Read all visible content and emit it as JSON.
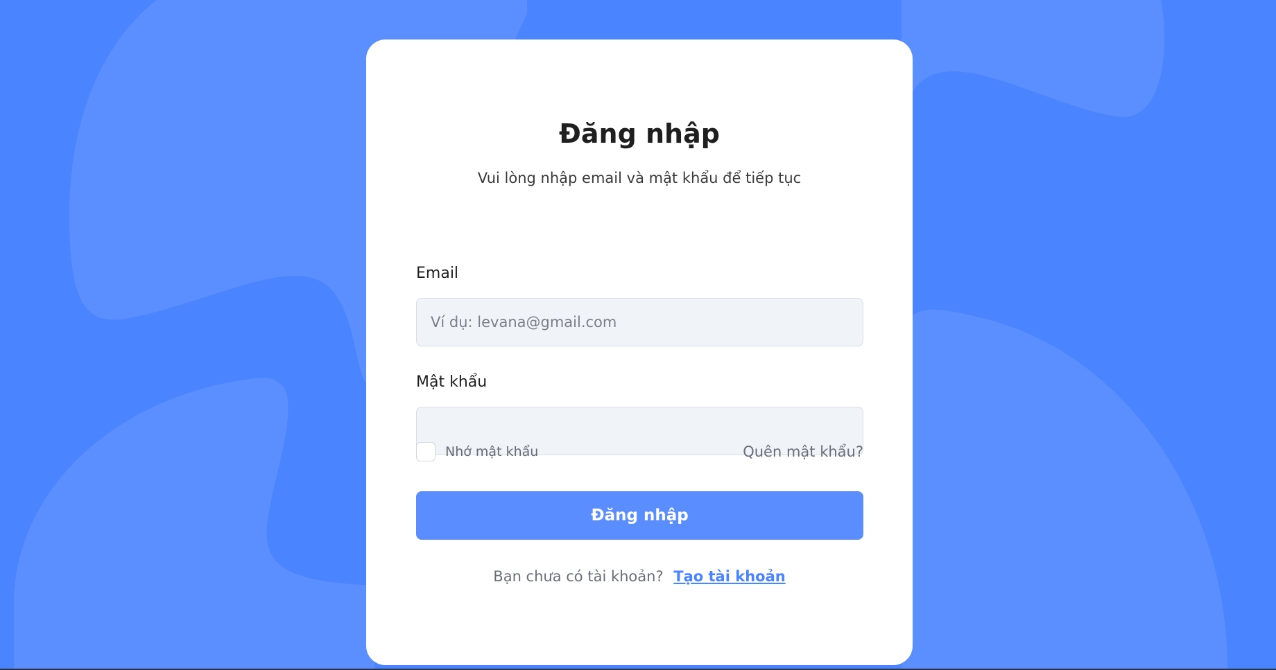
{
  "theme": {
    "background": "#4a84fe",
    "blob_color": "#5b8fff",
    "accent": "#5a8dff",
    "card": "#ffffff"
  },
  "login": {
    "title": "Đăng nhập",
    "subtitle": "Vui lòng nhập email và mật khẩu để tiếp tục",
    "email_label": "Email",
    "email_placeholder": "Ví dụ: levana@gmail.com",
    "email_value": "",
    "password_label": "Mật khẩu",
    "password_value": "",
    "remember_label": "Nhớ mật khẩu",
    "remember_checked": false,
    "forgot_label": "Quên mật khẩu?",
    "submit_label": "Đăng nhập",
    "signup_prompt": "Bạn chưa có tài khoản?",
    "signup_link": "Tạo tài khoản"
  }
}
